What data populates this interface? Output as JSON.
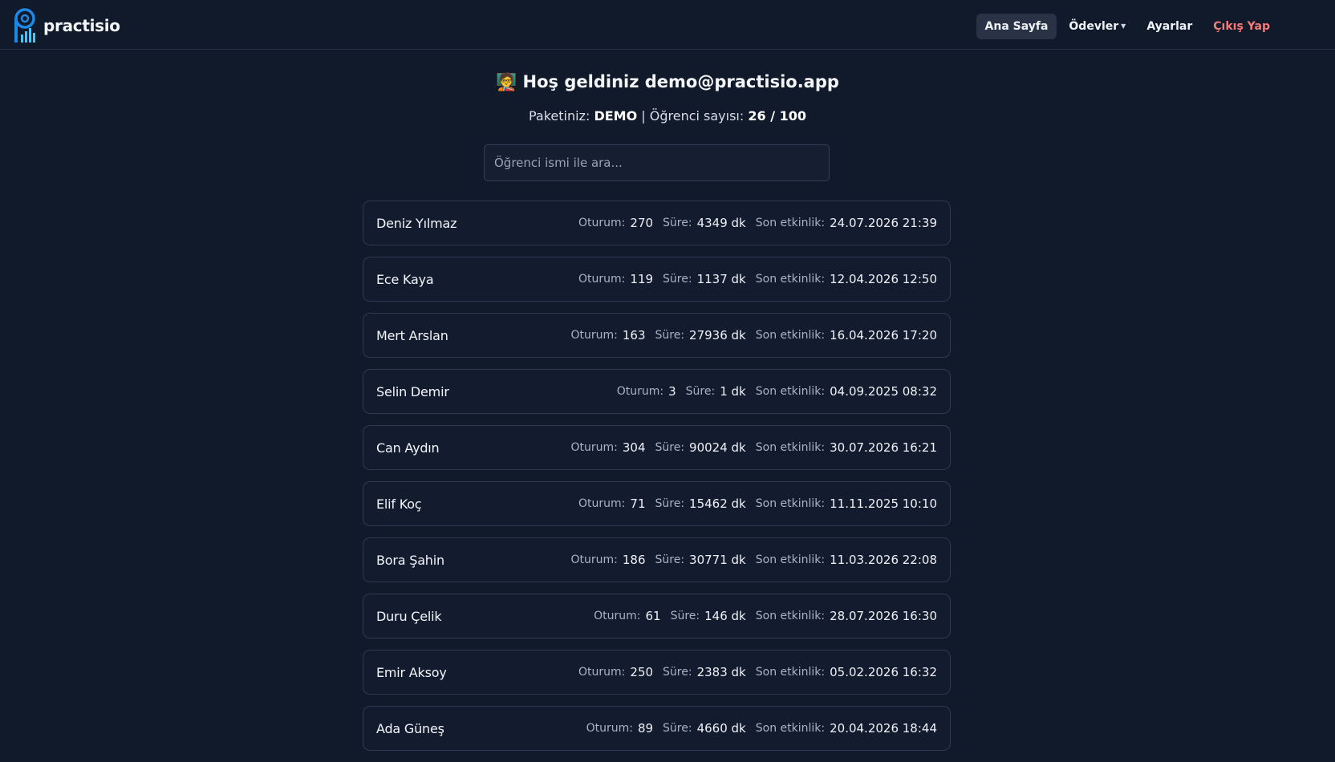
{
  "brand": {
    "name": "practisio"
  },
  "nav": {
    "home": "Ana Sayfa",
    "assignments": "Ödevler",
    "settings": "Ayarlar",
    "logout": "Çıkış Yap"
  },
  "header": {
    "emoji": "🧑‍🏫",
    "welcome": "Hoş geldiniz demo@practisio.app",
    "package_label": "Paketiniz:",
    "package_value": "DEMO",
    "separator": "|",
    "students_label": "Öğrenci sayısı:",
    "students_value": "26 / 100"
  },
  "search": {
    "placeholder": "Öğrenci ismi ile ara...",
    "value": ""
  },
  "labels": {
    "sessions": "Oturum:",
    "duration": "Süre:",
    "last_activity": "Son etkinlik:"
  },
  "students": [
    {
      "name": "Deniz Yılmaz",
      "sessions": "270",
      "duration": "4349 dk",
      "last": "24.07.2026 21:39"
    },
    {
      "name": "Ece Kaya",
      "sessions": "119",
      "duration": "1137 dk",
      "last": "12.04.2026 12:50"
    },
    {
      "name": "Mert Arslan",
      "sessions": "163",
      "duration": "27936 dk",
      "last": "16.04.2026 17:20"
    },
    {
      "name": "Selin Demir",
      "sessions": "3",
      "duration": "1 dk",
      "last": "04.09.2025 08:32"
    },
    {
      "name": "Can Aydın",
      "sessions": "304",
      "duration": "90024 dk",
      "last": "30.07.2026 16:21"
    },
    {
      "name": "Elif Koç",
      "sessions": "71",
      "duration": "15462 dk",
      "last": "11.11.2025 10:10"
    },
    {
      "name": "Bora Şahin",
      "sessions": "186",
      "duration": "30771 dk",
      "last": "11.03.2026 22:08"
    },
    {
      "name": "Duru Çelik",
      "sessions": "61",
      "duration": "146 dk",
      "last": "28.07.2026 16:30"
    },
    {
      "name": "Emir Aksoy",
      "sessions": "250",
      "duration": "2383 dk",
      "last": "05.02.2026 16:32"
    },
    {
      "name": "Ada Güneş",
      "sessions": "89",
      "duration": "4660 dk",
      "last": "20.04.2026 18:44"
    }
  ],
  "colors": {
    "background": "#111a2b",
    "accent": "#1e88e5",
    "logout": "#f47b7b"
  }
}
